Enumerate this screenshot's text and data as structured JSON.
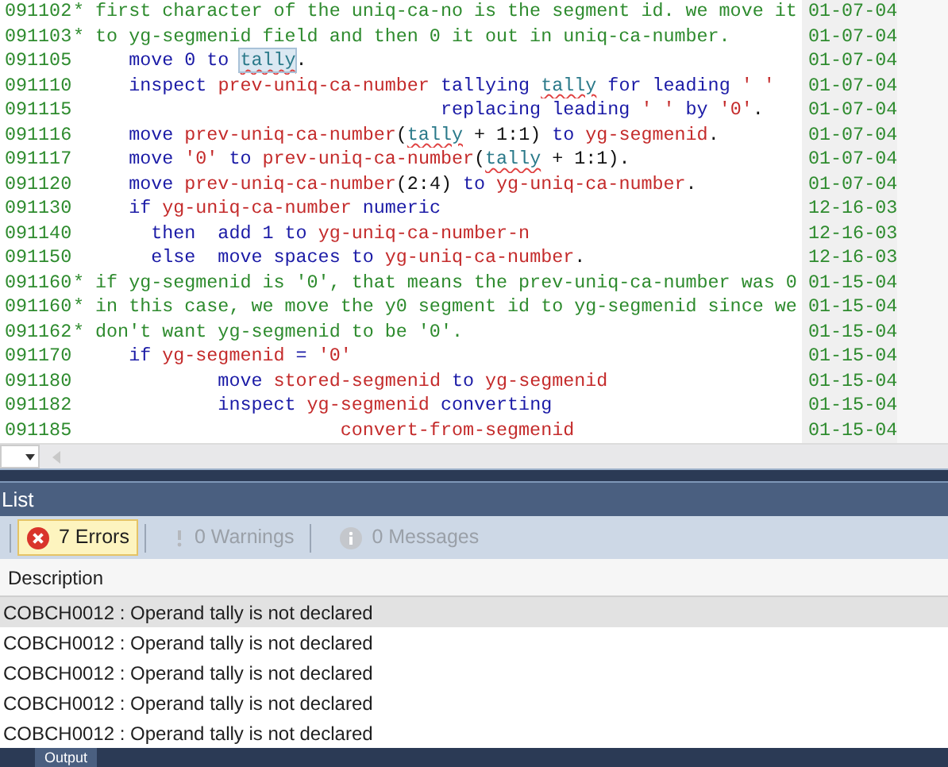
{
  "editor": {
    "lines": [
      {
        "number": "091102",
        "segments": [
          {
            "kind": "comment",
            "text": "* first character of the uniq-ca-no is the segment id. we move it"
          }
        ],
        "date": "01-07-04"
      },
      {
        "number": "091103",
        "segments": [
          {
            "kind": "comment",
            "text": "* to yg-segmenid field and then 0 it out in uniq-ca-number."
          }
        ],
        "date": "01-07-04"
      },
      {
        "number": "091105",
        "segments": [
          {
            "kind": "keyword",
            "text": "     move 0 to "
          },
          {
            "kind": "error",
            "text": "tally",
            "highlighted": true
          },
          {
            "kind": "plain",
            "text": "."
          }
        ],
        "date": "01-07-04"
      },
      {
        "number": "091110",
        "segments": [
          {
            "kind": "keyword",
            "text": "     inspect "
          },
          {
            "kind": "identifier",
            "text": "prev-uniq-ca-number"
          },
          {
            "kind": "keyword",
            "text": " tallying "
          },
          {
            "kind": "error",
            "text": "tally"
          },
          {
            "kind": "keyword",
            "text": " for leading "
          },
          {
            "kind": "identifier",
            "text": "' '"
          }
        ],
        "date": "01-07-04"
      },
      {
        "number": "091115",
        "segments": [
          {
            "kind": "keyword",
            "text": "                                 replacing leading "
          },
          {
            "kind": "identifier",
            "text": "' '"
          },
          {
            "kind": "keyword",
            "text": " by "
          },
          {
            "kind": "identifier",
            "text": "'0'"
          },
          {
            "kind": "plain",
            "text": "."
          }
        ],
        "date": "01-07-04"
      },
      {
        "number": "091116",
        "segments": [
          {
            "kind": "keyword",
            "text": "     move "
          },
          {
            "kind": "identifier",
            "text": "prev-uniq-ca-number"
          },
          {
            "kind": "plain",
            "text": "("
          },
          {
            "kind": "error",
            "text": "tally"
          },
          {
            "kind": "plain",
            "text": " + 1:1)"
          },
          {
            "kind": "keyword",
            "text": " to "
          },
          {
            "kind": "identifier",
            "text": "yg-segmenid"
          },
          {
            "kind": "plain",
            "text": "."
          }
        ],
        "date": "01-07-04"
      },
      {
        "number": "091117",
        "segments": [
          {
            "kind": "keyword",
            "text": "     move "
          },
          {
            "kind": "identifier",
            "text": "'0'"
          },
          {
            "kind": "keyword",
            "text": " to "
          },
          {
            "kind": "identifier",
            "text": "prev-uniq-ca-number"
          },
          {
            "kind": "plain",
            "text": "("
          },
          {
            "kind": "error",
            "text": "tally"
          },
          {
            "kind": "plain",
            "text": " + 1:1)."
          }
        ],
        "date": "01-07-04"
      },
      {
        "number": "091120",
        "segments": [
          {
            "kind": "keyword",
            "text": "     move "
          },
          {
            "kind": "identifier",
            "text": "prev-uniq-ca-number"
          },
          {
            "kind": "plain",
            "text": "(2:4)"
          },
          {
            "kind": "keyword",
            "text": " to "
          },
          {
            "kind": "identifier",
            "text": "yg-uniq-ca-number"
          },
          {
            "kind": "plain",
            "text": "."
          }
        ],
        "date": "01-07-04"
      },
      {
        "number": "091130",
        "segments": [
          {
            "kind": "keyword",
            "text": "     if "
          },
          {
            "kind": "identifier",
            "text": "yg-uniq-ca-number"
          },
          {
            "kind": "keyword",
            "text": " numeric"
          }
        ],
        "date": "12-16-03"
      },
      {
        "number": "091140",
        "segments": [
          {
            "kind": "keyword",
            "text": "       then  add 1 to "
          },
          {
            "kind": "identifier",
            "text": "yg-uniq-ca-number-n"
          }
        ],
        "date": "12-16-03"
      },
      {
        "number": "091150",
        "segments": [
          {
            "kind": "keyword",
            "text": "       else  move spaces to "
          },
          {
            "kind": "identifier",
            "text": "yg-uniq-ca-number"
          },
          {
            "kind": "plain",
            "text": "."
          }
        ],
        "date": "12-16-03"
      },
      {
        "number": "091160",
        "segments": [
          {
            "kind": "comment",
            "text": "* if yg-segmenid is '0', that means the prev-uniq-ca-number was 0"
          }
        ],
        "date": "01-15-04"
      },
      {
        "number": "091160",
        "segments": [
          {
            "kind": "comment",
            "text": "* in this case, we move the y0 segment id to yg-segmenid since we"
          }
        ],
        "date": "01-15-04"
      },
      {
        "number": "091162",
        "segments": [
          {
            "kind": "comment",
            "text": "* don't want yg-segmenid to be '0'."
          }
        ],
        "date": "01-15-04"
      },
      {
        "number": "091170",
        "segments": [
          {
            "kind": "keyword",
            "text": "     if "
          },
          {
            "kind": "identifier",
            "text": "yg-segmenid"
          },
          {
            "kind": "keyword",
            "text": " = "
          },
          {
            "kind": "identifier",
            "text": "'0'"
          }
        ],
        "date": "01-15-04"
      },
      {
        "number": "091180",
        "segments": [
          {
            "kind": "keyword",
            "text": "             move "
          },
          {
            "kind": "identifier",
            "text": "stored-segmenid"
          },
          {
            "kind": "keyword",
            "text": " to "
          },
          {
            "kind": "identifier",
            "text": "yg-segmenid"
          }
        ],
        "date": "01-15-04"
      },
      {
        "number": "091182",
        "segments": [
          {
            "kind": "keyword",
            "text": "             inspect "
          },
          {
            "kind": "identifier",
            "text": "yg-segmenid"
          },
          {
            "kind": "keyword",
            "text": " converting"
          }
        ],
        "date": "01-15-04"
      },
      {
        "number": "091185",
        "segments": [
          {
            "kind": "identifier",
            "text": "                        convert-from-segmenid"
          }
        ],
        "date": "01-15-04"
      }
    ]
  },
  "error_list": {
    "title": "List",
    "filters": [
      {
        "kind": "error",
        "label": "7 Errors",
        "selected": true
      },
      {
        "kind": "warning",
        "label": "0 Warnings",
        "selected": false
      },
      {
        "kind": "message",
        "label": "0 Messages",
        "selected": false
      }
    ],
    "columns": [
      "Description"
    ],
    "rows": [
      {
        "description": "COBCH0012 : Operand tally is not declared",
        "selected": true
      },
      {
        "description": "COBCH0012 : Operand tally is not declared",
        "selected": false
      },
      {
        "description": "COBCH0012 : Operand tally is not declared",
        "selected": false
      },
      {
        "description": "COBCH0012 : Operand tally is not declared",
        "selected": false
      },
      {
        "description": "COBCH0012 : Operand tally is not declared",
        "selected": false
      }
    ]
  },
  "bottom_tabs": [
    {
      "label": "Output",
      "selected": true
    }
  ]
}
